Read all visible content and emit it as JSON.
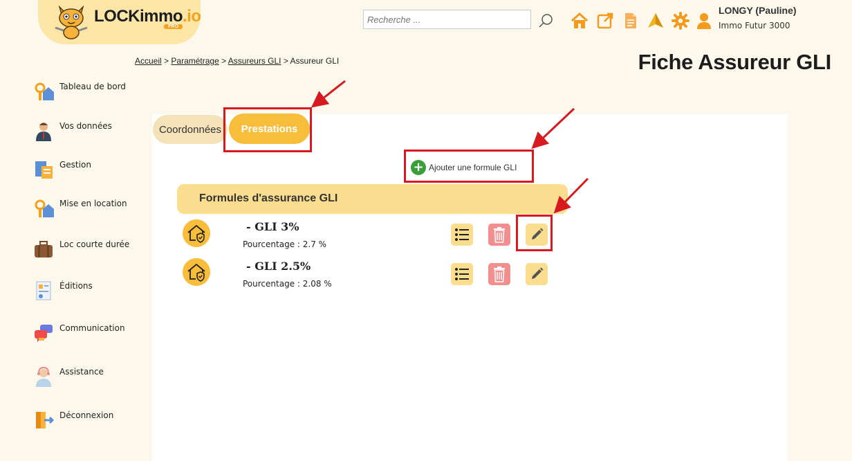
{
  "header": {
    "brand_main": "LOCKimmo",
    "brand_suffix": ".io",
    "brand_badge": "PRO",
    "search_placeholder": "Recherche ...",
    "icons": [
      "home-icon",
      "external-link-icon",
      "document-icon",
      "send-icon",
      "gear-icon",
      "user-icon"
    ],
    "user_name": "LONGY (Pauline)",
    "user_company": "Immo Futur 3000"
  },
  "breadcrumb": {
    "items": [
      "Accueil",
      "Paramétrage",
      "Assureurs GLI"
    ],
    "current": "Assureur GLI",
    "separator": ">"
  },
  "page_title": "Fiche Assureur GLI",
  "sidebar": {
    "items": [
      {
        "label": "Tableau de bord",
        "icon": "dashboard-key-house-icon"
      },
      {
        "label": "Vos données",
        "icon": "person-icon"
      },
      {
        "label": "Gestion",
        "icon": "gestion-icon"
      },
      {
        "label": "Mise en location",
        "icon": "rental-key-house-icon"
      },
      {
        "label": "Loc courte durée",
        "icon": "suitcase-icon"
      },
      {
        "label": "Éditions",
        "icon": "report-icon"
      },
      {
        "label": "Communication",
        "icon": "chat-bubbles-icon"
      },
      {
        "label": "Assistance",
        "icon": "support-agent-icon"
      },
      {
        "label": "Déconnexion",
        "icon": "logout-door-icon"
      }
    ]
  },
  "tabs": {
    "items": [
      {
        "label": "Coordonnées",
        "active": false
      },
      {
        "label": "Prestations",
        "active": true
      }
    ]
  },
  "add_formula_label": "Ajouter une formule GLI",
  "formulas": {
    "header": "Formules d'assurance GLI",
    "items": [
      {
        "name": "- GLI 3%",
        "detail": "Pourcentage : 2.7 %"
      },
      {
        "name": "- GLI 2.5%",
        "detail": "Pourcentage : 2.08 %"
      }
    ]
  },
  "colors": {
    "accent": "#f9bd3c",
    "accent_light": "#fbdd8f",
    "delete": "#f28e8e",
    "annotation": "#d71920"
  }
}
